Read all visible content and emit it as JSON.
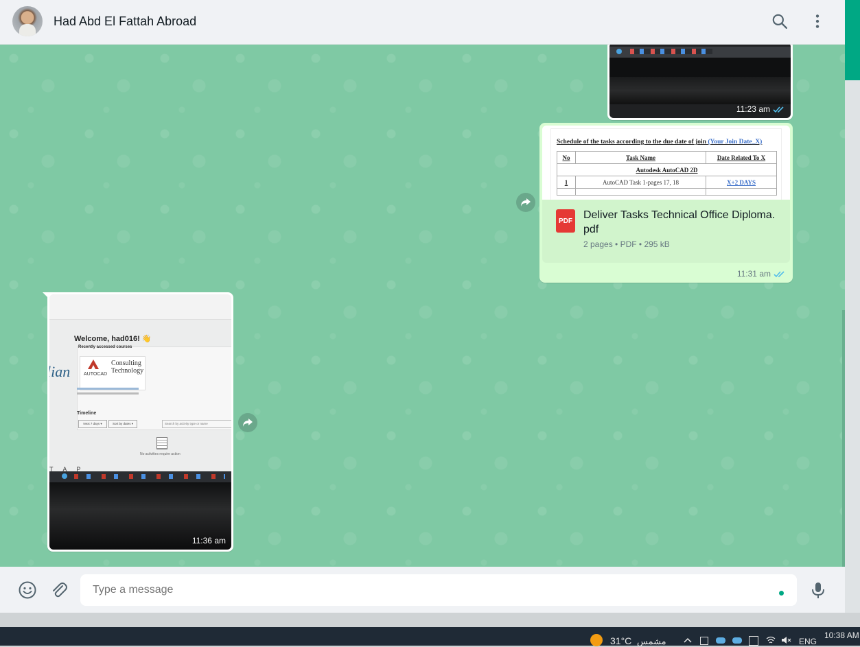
{
  "header": {
    "contact_name": "Had Abd El Fattah Abroad",
    "search_icon": "search-icon",
    "menu_icon": "vertical-dots-icon"
  },
  "messages": {
    "img1": {
      "time": "11:23 am",
      "status": "read"
    },
    "doc": {
      "preview": {
        "heading": "Schedule of the tasks according to the due date of join",
        "heading_link": "(Your Join Date_X)",
        "col_no": "No",
        "col_task": "Task Name",
        "col_date": "Date Related To X",
        "section": "Autodesk AutoCAD 2D",
        "row1_no": "1",
        "row1_task": "AutoCAD Task 1-pages 17, 18",
        "row1_date": "X+2 DAYS"
      },
      "icon_label": "PDF",
      "file_name": "Deliver Tasks Technical Office Diploma. pdf",
      "meta": "2 pages • PDF • 295 kB",
      "time": "11:31 am",
      "status": "read"
    },
    "img2": {
      "welcome": "Welcome, had016! 👋",
      "recent": "Recently accessed courses",
      "course_logo": "AUTOCAD",
      "course_title": "Consulting Technology",
      "timeline": "Timeline",
      "filter1": "Next 7 days ▾",
      "filter2": "Sort by dates ▾",
      "search_placeholder": "Search by activity type or name",
      "no_activities": "No activities require action",
      "time": "11:36 am"
    }
  },
  "footer": {
    "placeholder": "Type a message",
    "emoji_icon": "emoji-icon",
    "attach_icon": "paperclip-icon",
    "mic_icon": "microphone-icon"
  },
  "taskbar": {
    "temperature": "31°C",
    "weather": "مشمس",
    "language": "ENG",
    "clock": "10:38 AM"
  },
  "colors": {
    "accent": "#00a884",
    "chat_bg": "#7fc9a4",
    "outgoing_bubble": "#d9fdd3",
    "read_tick": "#53bdeb"
  }
}
